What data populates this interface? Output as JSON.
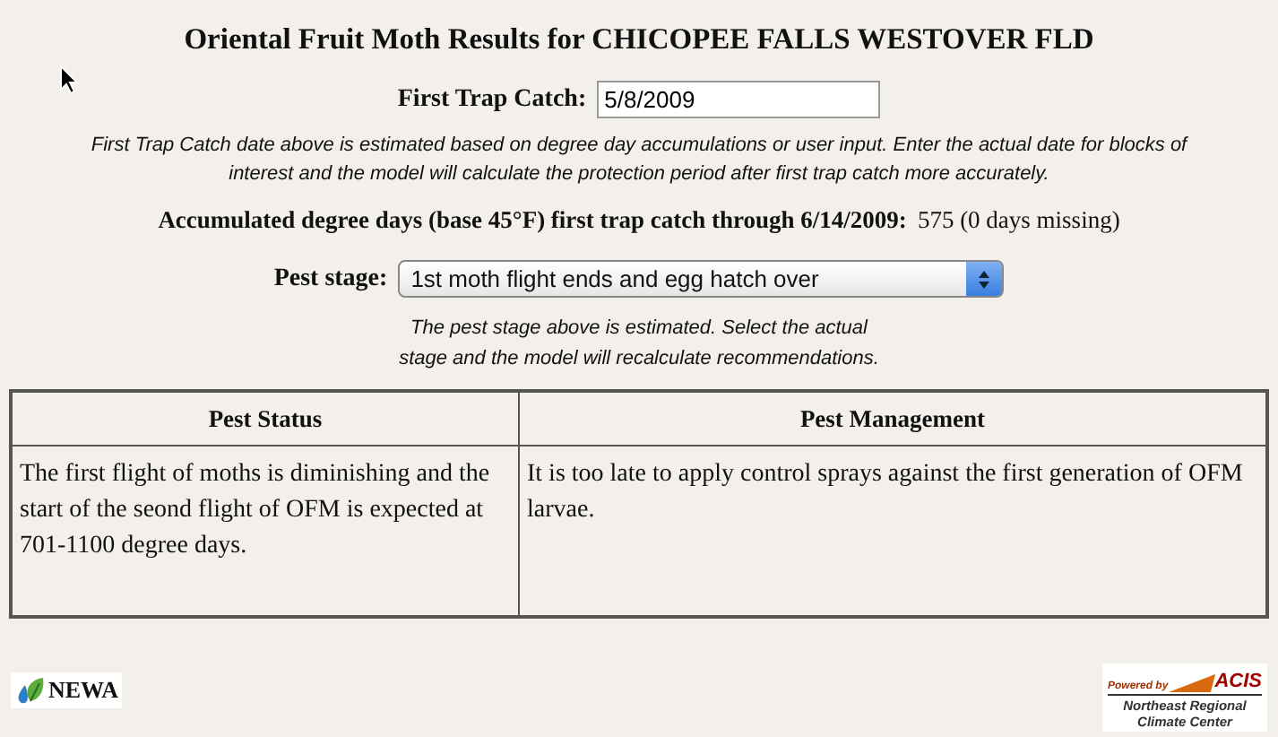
{
  "title": "Oriental Fruit Moth Results for CHICOPEE FALLS WESTOVER FLD",
  "first_trap": {
    "label": "First Trap Catch:",
    "value": "5/8/2009"
  },
  "trap_note": "First Trap Catch date above is estimated based on degree day accumulations or user input. Enter the actual date for blocks of interest and the model will calculate the protection period after first trap catch more accurately.",
  "accumulated": {
    "label": "Accumulated degree days (base 45°F) first trap catch through 6/14/2009:",
    "value": "575 (0 days missing)"
  },
  "pest_stage": {
    "label": "Pest stage:",
    "value": "1st moth flight ends and egg hatch over"
  },
  "stage_note": [
    "The pest stage above is estimated. Select the actual",
    "stage and the model will recalculate recommendations."
  ],
  "table": {
    "columns": [
      "Pest Status",
      "Pest Management"
    ],
    "rows": [
      [
        "The first flight of moths is diminishing and the start of the seond flight of OFM is expected at 701-1100 degree days.",
        "It is too late to apply control sprays against the first generation of OFM larvae."
      ]
    ]
  },
  "footer": {
    "newa": "NEWA",
    "acis_powered": "Powered by",
    "acis": "ACIS",
    "acis_center": "Northeast Regional Climate Center"
  }
}
